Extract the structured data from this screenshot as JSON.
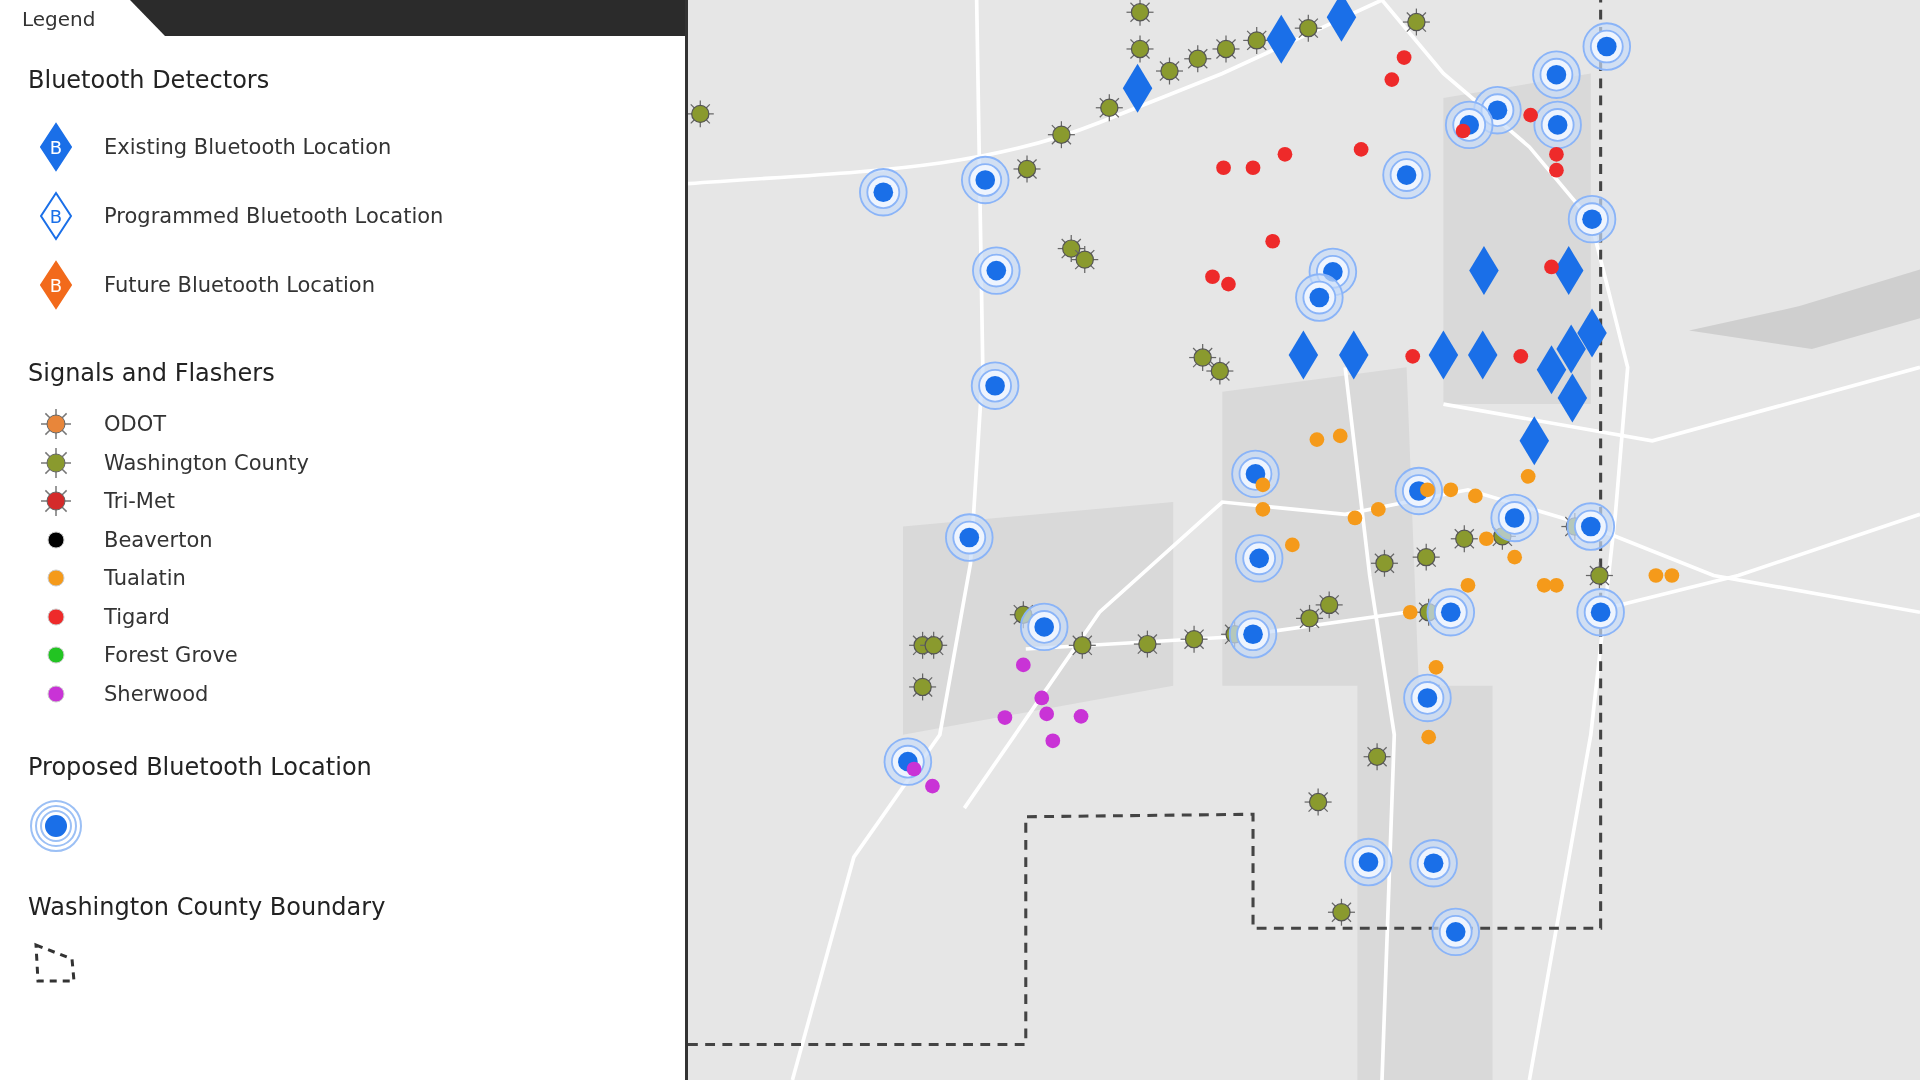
{
  "legend": {
    "tab": "Legend",
    "sections": [
      {
        "title": "Bluetooth Detectors",
        "items": [
          {
            "kind": "diamond",
            "label": "Existing Bluetooth Location",
            "color": "#1a6fe8",
            "outline": false,
            "badge": "B"
          },
          {
            "kind": "diamond",
            "label": "Programmed Bluetooth Location",
            "color": "#1a6fe8",
            "outline": true,
            "badge": "B"
          },
          {
            "kind": "diamond",
            "label": "Future Bluetooth Location",
            "color": "#f26a1b",
            "outline": false,
            "badge": "B"
          }
        ]
      },
      {
        "title": "Signals and Flashers",
        "items": [
          {
            "kind": "signal",
            "label": "ODOT",
            "color": "#e8863a"
          },
          {
            "kind": "signal",
            "label": "Washington County",
            "color": "#8a9a2e"
          },
          {
            "kind": "signal",
            "label": "Tri-Met",
            "color": "#d42a2a"
          },
          {
            "kind": "dot",
            "label": "Beaverton",
            "color": "#000000"
          },
          {
            "kind": "dot",
            "label": "Tualatin",
            "color": "#f59a1a"
          },
          {
            "kind": "dot",
            "label": "Tigard",
            "color": "#ee2a2a"
          },
          {
            "kind": "dot",
            "label": "Forest Grove",
            "color": "#22c422"
          },
          {
            "kind": "dot",
            "label": "Sherwood",
            "color": "#c933d6"
          }
        ]
      },
      {
        "title": "Proposed Bluetooth Location",
        "items": [
          {
            "kind": "target",
            "color": "#1a6fe8"
          }
        ]
      },
      {
        "title": "Washington County Boundary",
        "items": [
          {
            "kind": "boundary",
            "color": "#333333"
          }
        ]
      }
    ]
  }
}
